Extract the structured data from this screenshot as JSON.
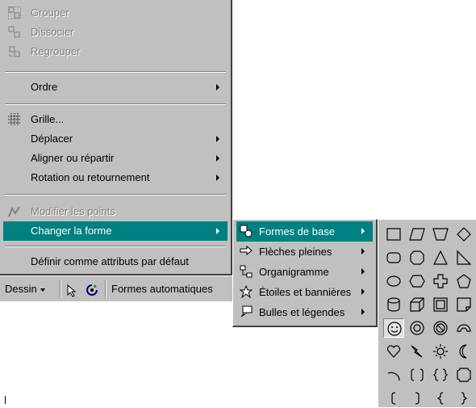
{
  "menu": {
    "grouper": "Grouper",
    "dissocier": "Dissocier",
    "regrouper": "Regrouper",
    "ordre": "Ordre",
    "grille": "Grille...",
    "deplacer": "Déplacer",
    "aligner": "Aligner ou répartir",
    "rotation": "Rotation ou retournement",
    "modifier_points": "Modifier les points",
    "changer_forme": "Changer la forme",
    "definir_defaut": "Définir comme attributs par défaut"
  },
  "toolbar": {
    "dessin": "Dessin",
    "formes_auto": "Formes automatiques"
  },
  "submenu": {
    "formes_base": "Formes de base",
    "fleches": "Flèches pleines",
    "organigramme": "Organigramme",
    "etoiles": "Étoiles et bannières",
    "bulles": "Bulles et légendes"
  },
  "palette": {
    "rows": [
      [
        "rectangle-icon",
        "parallelogram-icon",
        "trapezoid-icon",
        "diamond-icon"
      ],
      [
        "rounded-rectangle-icon",
        "octagon-icon",
        "triangle-icon",
        "right-triangle-icon"
      ],
      [
        "ellipse-icon",
        "hexagon-icon",
        "cross-icon",
        "pentagon-icon"
      ],
      [
        "can-icon",
        "cube-icon",
        "bevel-icon",
        "folded-corner-icon"
      ],
      [
        "smiley-icon",
        "donut-icon",
        "no-symbol-icon",
        "block-arc-icon"
      ],
      [
        "heart-icon",
        "lightning-icon",
        "sun-icon",
        "moon-icon"
      ],
      [
        "arc-icon",
        "double-bracket-icon",
        "double-brace-icon",
        "plaque-icon"
      ],
      [
        "left-bracket-icon",
        "right-bracket-icon",
        "left-brace-icon",
        "right-brace-icon"
      ]
    ],
    "selected": "smiley-icon"
  },
  "colors": {
    "highlight": "#008080",
    "menu_bg": "#c0c0c0",
    "disabled": "#808080"
  }
}
